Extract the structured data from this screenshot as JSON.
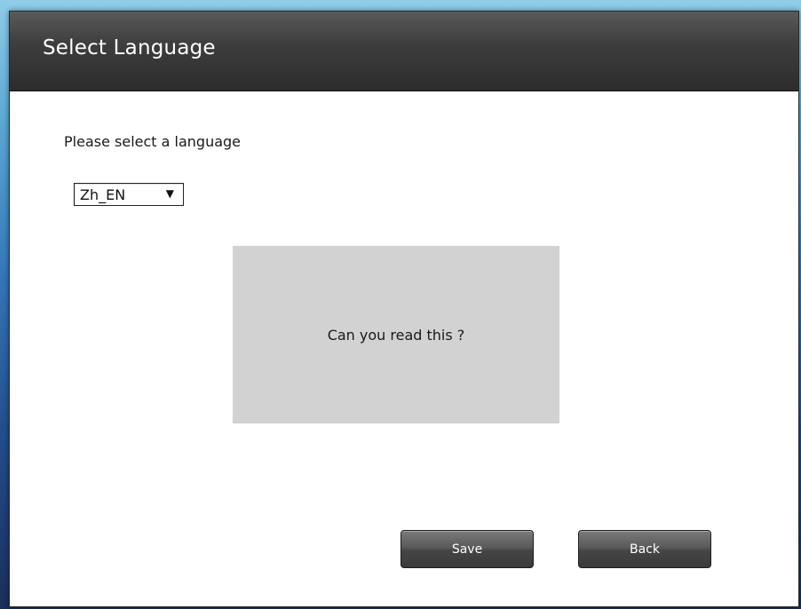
{
  "dialog": {
    "title": "Select Language",
    "prompt": "Please select a language",
    "language_select": {
      "selected": "Zh_EN",
      "arrow_icon": "dropdown-triangle-icon"
    },
    "preview": {
      "text": "Can you read this ?"
    },
    "buttons": {
      "save_label": "Save",
      "back_label": "Back"
    }
  },
  "colors": {
    "titlebar": "#3a3a3a",
    "preview_bg": "#d2d2d2",
    "button_bg": "#4a4a4a",
    "dialog_bg": "#ffffff"
  }
}
